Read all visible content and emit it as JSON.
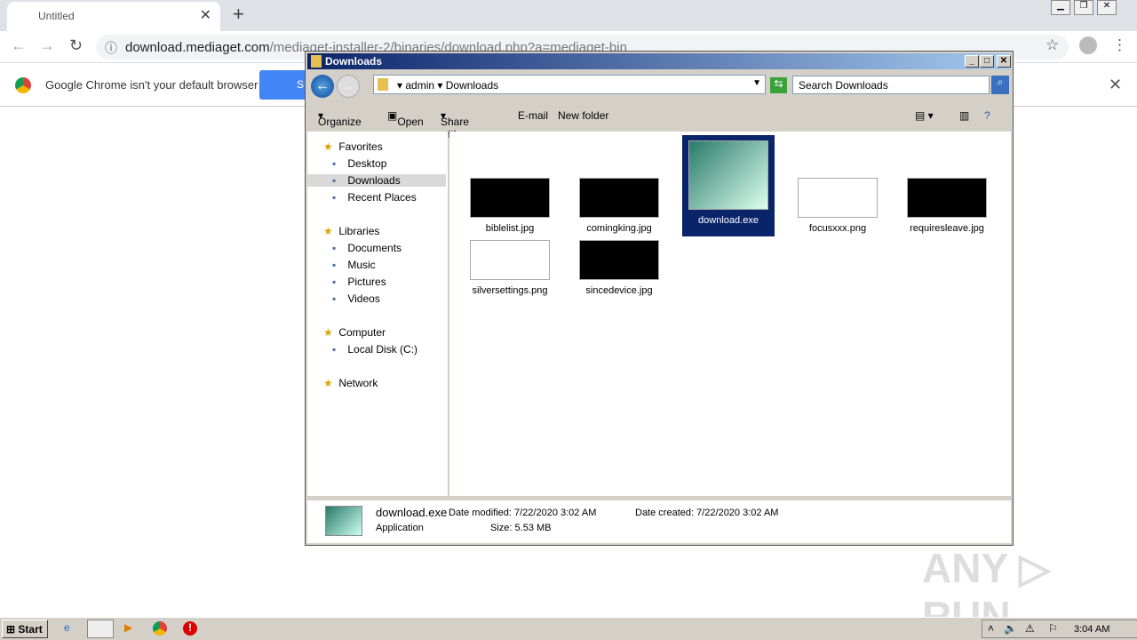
{
  "browser": {
    "tab_title": "Untitled",
    "url_host": "download.mediaget.com",
    "url_path": "/mediaget-installer-2/binaries/download.php?a=mediaget-bin",
    "infobar_text": "Google Chrome isn't your default browser",
    "infobar_button": "S"
  },
  "explorer": {
    "title": "Downloads",
    "breadcrumb": [
      "admin",
      "Downloads"
    ],
    "search_placeholder": "Search Downloads",
    "commands": [
      "Organize",
      "Open",
      "Share with",
      "E-mail",
      "New folder"
    ],
    "nav": [
      {
        "label": "Favorites",
        "group": true
      },
      {
        "label": "Desktop"
      },
      {
        "label": "Downloads",
        "selected": true
      },
      {
        "label": "Recent Places"
      },
      {
        "label": "Libraries",
        "group": true
      },
      {
        "label": "Documents"
      },
      {
        "label": "Music"
      },
      {
        "label": "Pictures"
      },
      {
        "label": "Videos"
      },
      {
        "label": "Computer",
        "group": true
      },
      {
        "label": "Local Disk (C:)"
      },
      {
        "label": "Network",
        "group": true
      }
    ],
    "files": [
      {
        "name": "biblelist.jpg",
        "bg": "#000"
      },
      {
        "name": "comingking.jpg",
        "bg": "#000"
      },
      {
        "name": "download.exe",
        "bg": "#5a9a8a",
        "selected": true
      },
      {
        "name": "focusxxx.png",
        "bg": "#fff"
      },
      {
        "name": "requiresleave.jpg",
        "bg": "#000"
      },
      {
        "name": "silversettings.png",
        "bg": "#fff"
      },
      {
        "name": "sincedevice.jpg",
        "bg": "#000"
      }
    ],
    "details": {
      "name": "download.exe",
      "type": "Application",
      "modified_label": "Date modified:",
      "modified": "7/22/2020 3:02 AM",
      "created_label": "Date created:",
      "created": "7/22/2020 3:02 AM",
      "size_label": "Size:",
      "size": "5.53 MB"
    }
  },
  "taskbar": {
    "start": "Start",
    "clock": "3:04 AM"
  },
  "watermark": "ANY RUN"
}
